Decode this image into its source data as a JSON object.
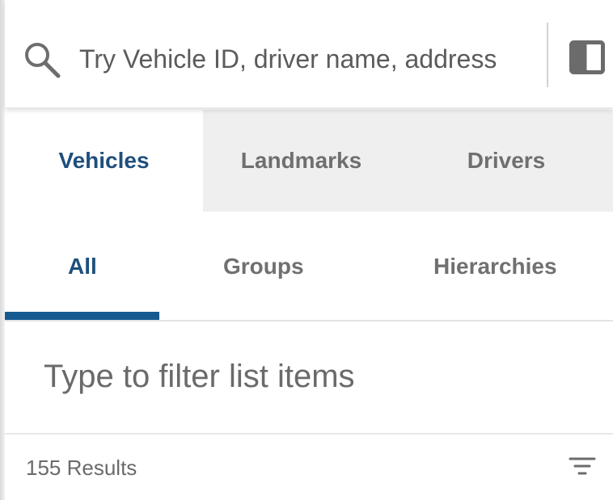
{
  "search": {
    "placeholder": "Try Vehicle ID, driver name, address",
    "icon": "search-icon",
    "toggle_icon": "panel-toggle-icon"
  },
  "top_tabs": [
    {
      "label": "Vehicles",
      "active": true
    },
    {
      "label": "Landmarks",
      "active": false
    },
    {
      "label": "Drivers",
      "active": false
    }
  ],
  "sub_tabs": [
    {
      "label": "All",
      "active": true
    },
    {
      "label": "Groups",
      "active": false
    },
    {
      "label": "Hierarchies",
      "active": false
    }
  ],
  "filter": {
    "placeholder": "Type to filter list items"
  },
  "results": {
    "count_text": "155 Results",
    "sort_icon": "sort-filter-icon"
  },
  "colors": {
    "accent": "#165a8f",
    "active_text": "#1f4f7d",
    "inactive_tab_bg": "#efefef"
  }
}
